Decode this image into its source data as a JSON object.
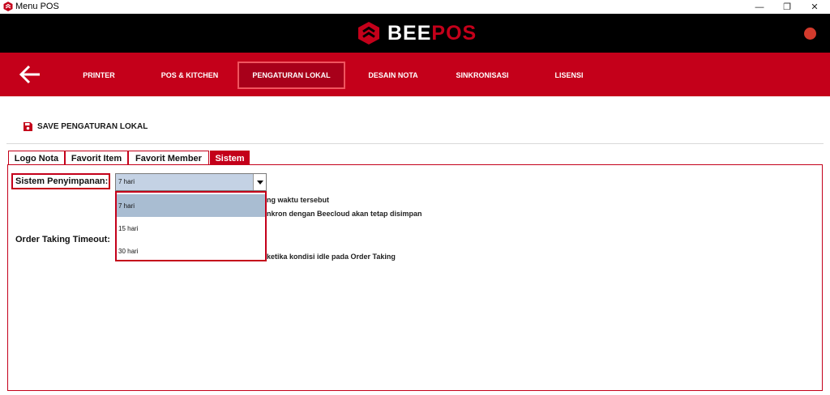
{
  "window": {
    "title": "Menu POS",
    "controls": {
      "minimize": "—",
      "maximize": "❐",
      "close": "✕"
    }
  },
  "brand": {
    "part1": "BEE",
    "part2": "POS"
  },
  "colors": {
    "brand_red": "#c4001a",
    "bar_black": "#000000",
    "status_dot": "#d23a2c",
    "selection": "#a9bdd2"
  },
  "nav": {
    "items": [
      {
        "label": "PRINTER",
        "active": false
      },
      {
        "label": "POS & KITCHEN",
        "active": false
      },
      {
        "label": "PENGATURAN LOKAL",
        "active": true
      },
      {
        "label": "DESAIN NOTA",
        "active": false
      },
      {
        "label": "SINKRONISASI",
        "active": false
      },
      {
        "label": "LISENSI",
        "active": false
      }
    ]
  },
  "toolbar": {
    "save_label": "SAVE PENGATURAN LOKAL"
  },
  "tabs": [
    {
      "label": "Logo Nota",
      "active": false
    },
    {
      "label": "Favorit Item",
      "active": false
    },
    {
      "label": "Favorit Member",
      "active": false
    },
    {
      "label": "Sistem",
      "active": true
    }
  ],
  "sistem": {
    "storage_label": "Sistem Penyimpanan:",
    "storage_value": "7 hari",
    "storage_options": [
      "7 hari",
      "15 hari",
      "30 hari"
    ],
    "storage_desc_1": "ng waktu tersebut",
    "storage_desc_2": "nkron dengan Beecloud akan tetap disimpan",
    "timeout_label": "Order Taking Timeout:",
    "timeout_desc": "ketika kondisi idle pada Order Taking"
  }
}
